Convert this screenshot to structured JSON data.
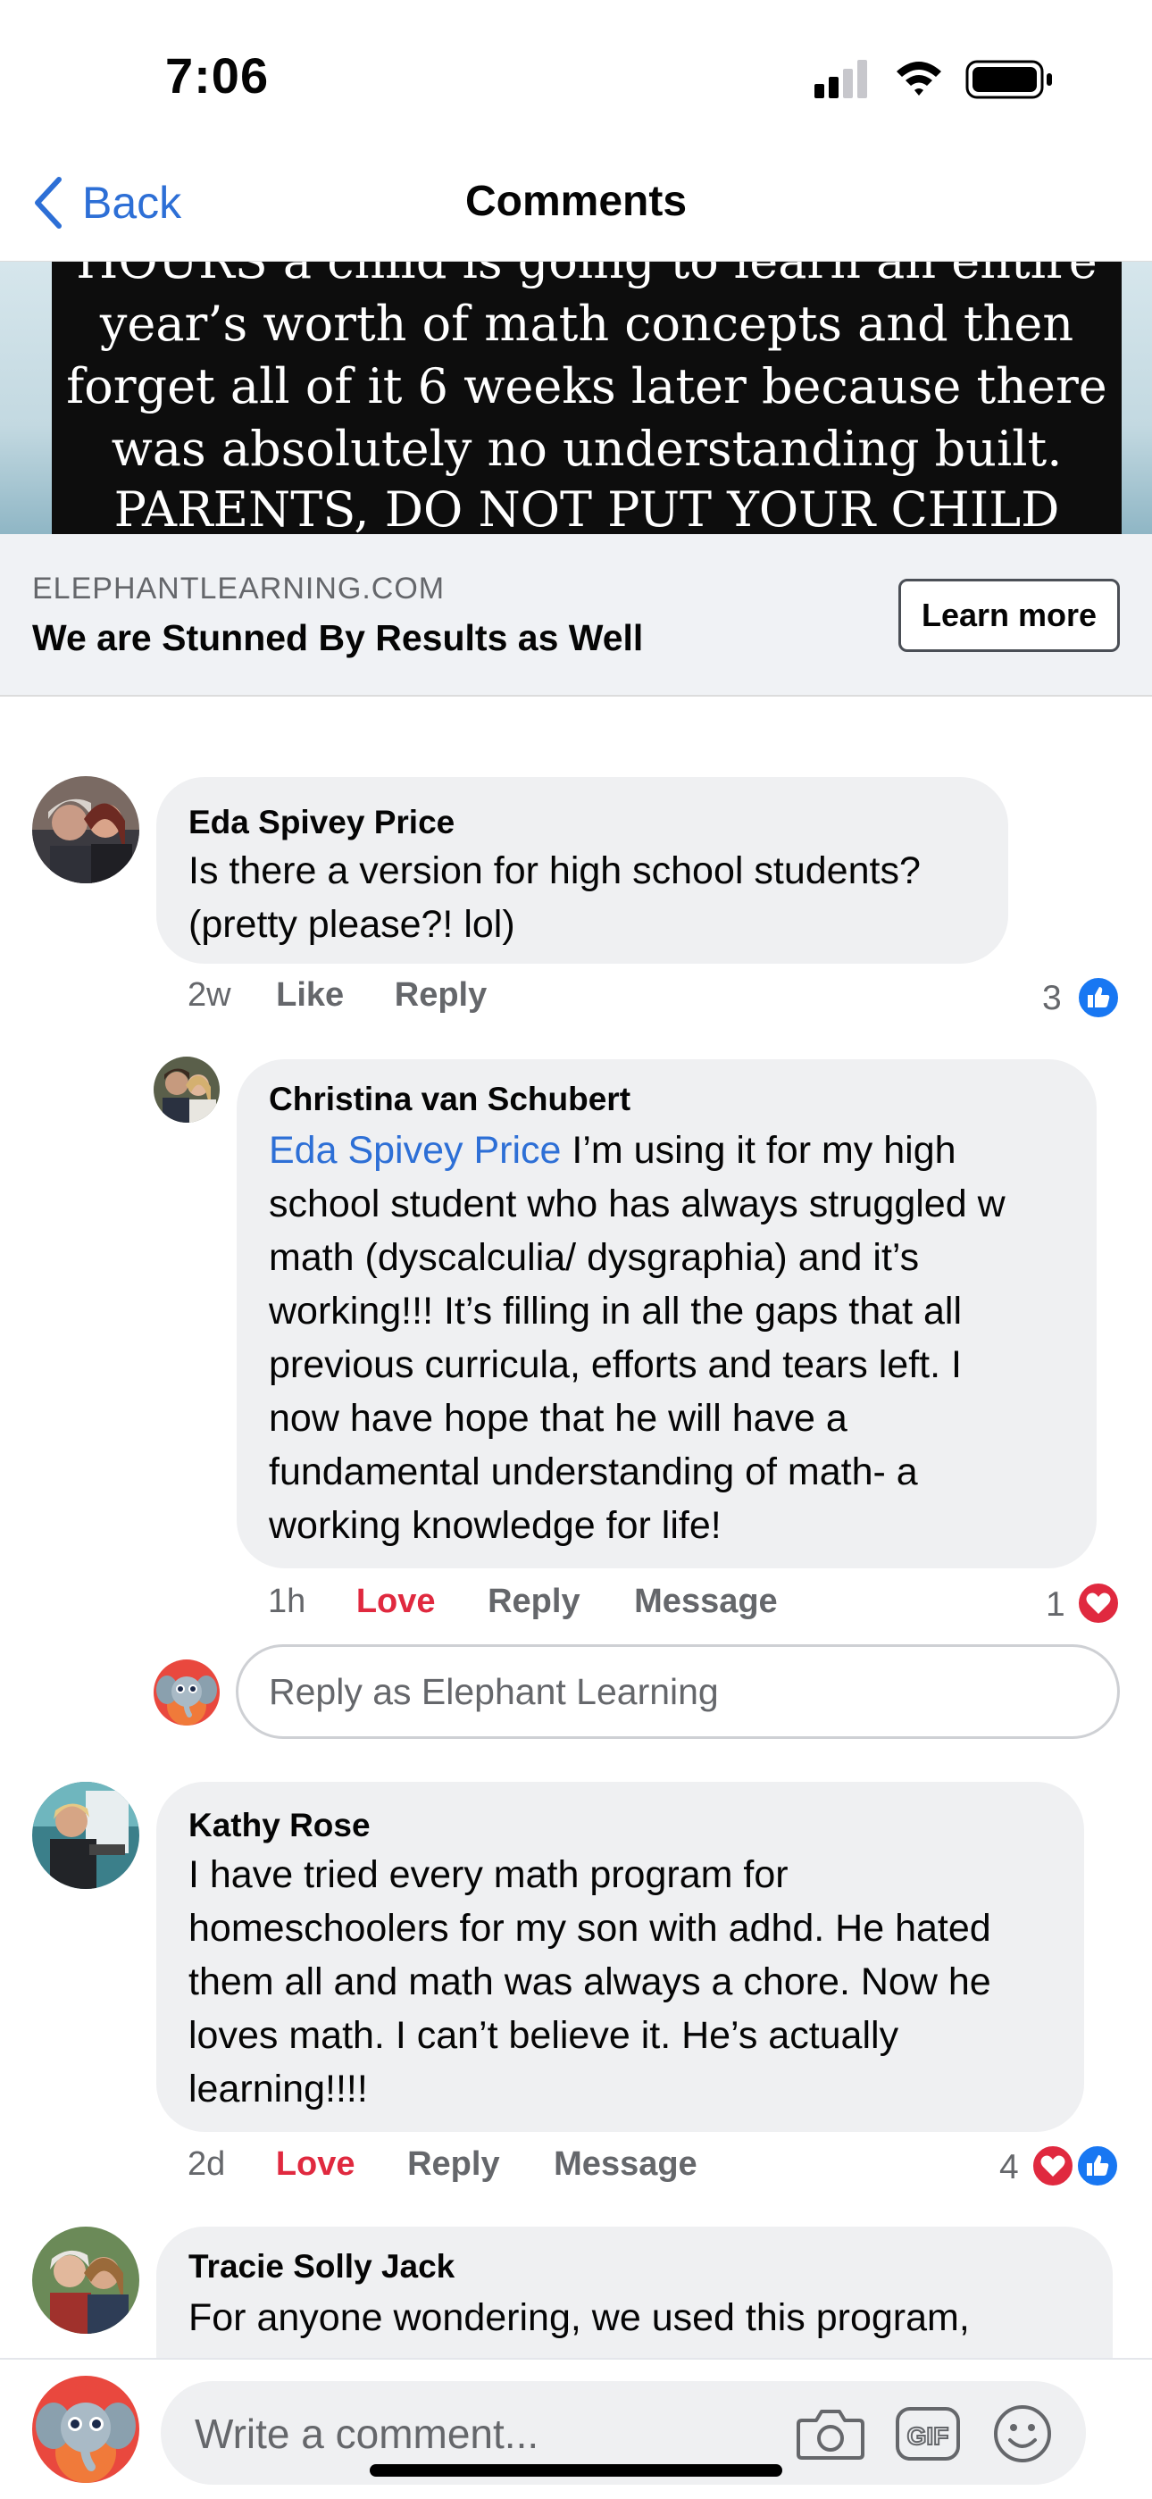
{
  "status_bar": {
    "time": "7:06"
  },
  "nav": {
    "back_label": "Back",
    "title": "Comments"
  },
  "ad": {
    "image_lines": [
      "HOURS a child is going to learn an entire",
      "year’s worth of math concepts and then",
      "forget all of it 6 weeks later because there",
      "was absolutely no understanding built.",
      "PARENTS, DO NOT PUT YOUR CHILD"
    ],
    "domain": "ELEPHANTLEARNING.COM",
    "headline": "We are Stunned By Results as Well",
    "cta_label": "Learn more"
  },
  "comments": [
    {
      "author": "Eda Spivey Price",
      "lines": [
        "Is there a version for high school students?",
        "(pretty please?! lol)"
      ],
      "time": "2w",
      "action_1": "Like",
      "action_2": "Reply",
      "reaction_count": "3"
    },
    {
      "author": "Christina van Schubert",
      "mention": "Eda Spivey Price",
      "lines": [
        " I’m using it for my high",
        "school student who has always struggled w",
        "math (dyscalculia/ dysgraphia) and it’s",
        "working!!! It’s filling in all the gaps that all",
        "previous curricula, efforts and tears left. I",
        "now have hope that he will have a",
        "fundamental understanding of math- a",
        "working knowledge for life!"
      ],
      "time": "1h",
      "action_1": "Love",
      "action_2": "Reply",
      "action_3": "Message",
      "reaction_count": "1"
    },
    {
      "author": "Kathy Rose",
      "lines": [
        "I have tried every math program for",
        "homeschoolers for my son with adhd. He hated",
        "them all and math was always a chore. Now he",
        "loves math. I can’t believe it. He’s actually",
        "learning!!!!"
      ],
      "time": "2d",
      "action_1": "Love",
      "action_2": "Reply",
      "action_3": "Message",
      "reaction_count": "4"
    },
    {
      "author": "Tracie Solly Jack",
      "lines": [
        "For anyone wondering, we used this program,"
      ]
    }
  ],
  "reply_box": {
    "placeholder": "Reply as Elephant Learning"
  },
  "composer": {
    "placeholder": "Write a comment..."
  },
  "colors": {
    "accent": "#2d6fd6",
    "love": "#e0293f",
    "like": "#1877f2",
    "bubble": "#eff0f2"
  }
}
